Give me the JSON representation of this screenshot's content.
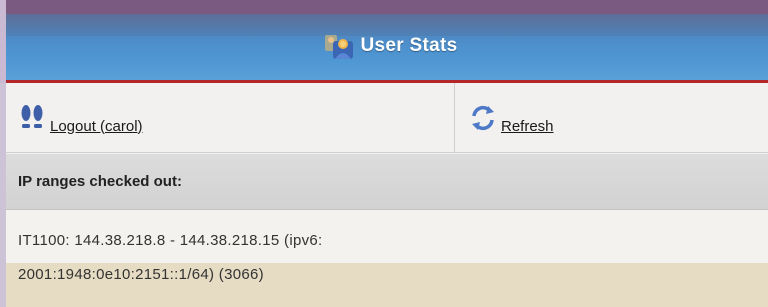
{
  "header": {
    "title": "User Stats",
    "icon": "user-icon",
    "colors": {
      "accent_rule": "#b3272b",
      "title_text": "#ffffff"
    }
  },
  "actions": {
    "logout": {
      "label": "Logout (carol)",
      "icon": "footsteps-icon"
    },
    "refresh": {
      "label": "Refresh",
      "icon": "refresh-icon"
    }
  },
  "ip_ranges": {
    "heading": "IP ranges checked out:",
    "entries": [
      {
        "line1": "IT1100: 144.38.218.8 - 144.38.218.15 (ipv6:",
        "line2": "2001:1948:0e10:2151::1/64) (3066)"
      }
    ]
  }
}
